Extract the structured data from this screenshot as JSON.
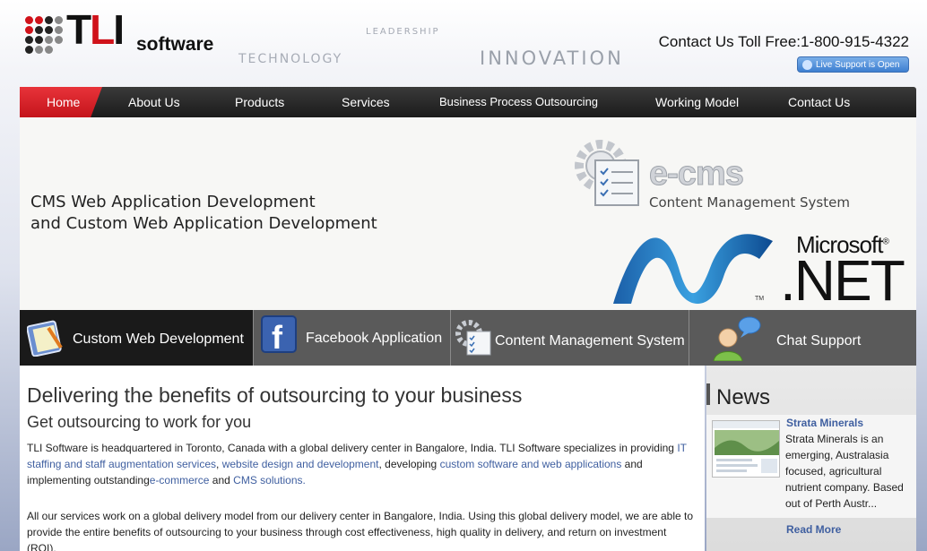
{
  "header": {
    "logo_main": "TLI",
    "logo_suffix": "software",
    "tag_leadership": "LEADERSHIP",
    "tag_technology": "TECHNOLOGY",
    "tag_innovation": "INNOVATION",
    "tollfree": "Contact Us Toll Free:1-800-915-4322",
    "live_support": "Live Support is Open"
  },
  "nav": {
    "items": [
      "Home",
      "About Us",
      "Products",
      "Services",
      "Business Process Outsourcing",
      "Working Model",
      "Contact Us"
    ],
    "active": "Home",
    "active_color": "#d81f26"
  },
  "banner": {
    "headline_line1": "CMS Web Application Development",
    "headline_line2": "and Custom Web Application Development",
    "ecms_title": "e-cms",
    "ecms_subtitle": "Content Management System",
    "ms_brand": "Microsoft",
    "net_brand": ".NET",
    "tm": "TM"
  },
  "features": {
    "items": [
      {
        "label": "Custom Web Development",
        "icon": "notepad-icon",
        "active": true
      },
      {
        "label": "Facebook Application",
        "icon": "facebook-icon",
        "active": false
      },
      {
        "label": "Content Management System",
        "icon": "cms-gear-icon",
        "active": false
      },
      {
        "label": "Chat Support",
        "icon": "chat-user-icon",
        "active": false
      }
    ]
  },
  "main": {
    "heading": "Delivering the benefits of outsourcing to your business",
    "subheading": "Get outsourcing to work for you",
    "p1_a": "TLI Software is headquartered in Toronto, Canada with a global delivery center in Bangalore, India. TLI Software specializes in providing ",
    "p1_link1": "IT staffing and staff augmentation services",
    "p1_b": ", ",
    "p1_link2": "website design and development",
    "p1_c": ", developing ",
    "p1_link3": "custom software and web applications",
    "p1_d": " and implementing outstanding",
    "p1_link4": "e-commerce",
    "p1_e": " and ",
    "p1_link5": "CMS solutions.",
    "p2": "All our services work on a global delivery model from our delivery center in Bangalore, India. Using this global delivery model, we are able to provide the entire benefits of outsourcing to your business through cost effectiveness, high quality in delivery, and return on investment (ROI)."
  },
  "news": {
    "title": "News",
    "item_title": "Strata Minerals",
    "item_text": "Strata Minerals is an emerging, Australasia focused, agricultural nutrient company. Based out of Perth Austr...",
    "read_more": "Read More"
  }
}
